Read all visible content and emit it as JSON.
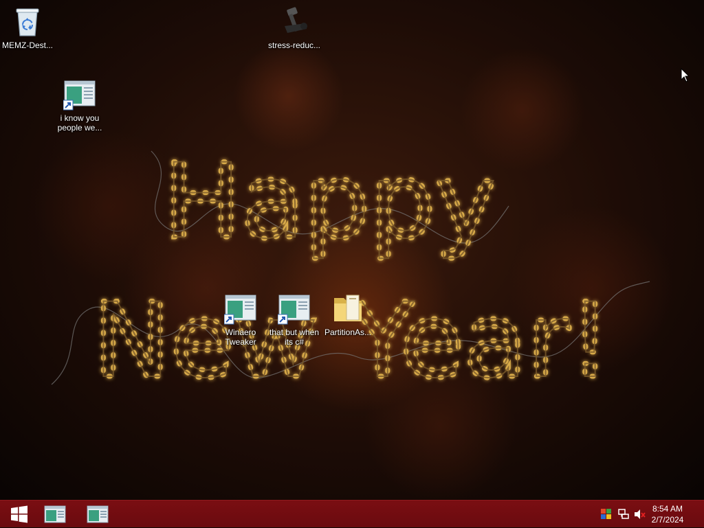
{
  "desktop": {
    "greeting_text": [
      "Happy",
      "New Year!"
    ],
    "icons": [
      {
        "label": "MEMZ-Dest...",
        "icon": "recycle-bin-icon"
      },
      {
        "label": "stress-reduc...",
        "icon": "hammer-tool-icon"
      },
      {
        "label": "i know you people we...",
        "icon": "program-shortcut-icon"
      },
      {
        "label": "Winaero Tweaker",
        "icon": "program-shortcut-icon"
      },
      {
        "label": "that but when its c#",
        "icon": "program-shortcut-icon"
      },
      {
        "label": "PartitionAs...",
        "icon": "folder-icon"
      }
    ]
  },
  "taskbar": {
    "start_icon": "windows-logo-icon",
    "pinned": [
      {
        "name": "taskbar-app-1",
        "icon": "program-window-icon"
      },
      {
        "name": "taskbar-app-2",
        "icon": "program-window-icon"
      }
    ],
    "tray_icons": [
      "action-center-flag-icon",
      "network-icon",
      "volume-muted-icon"
    ],
    "clock": {
      "time": "8:54 AM",
      "date": "2/7/2024"
    },
    "color": "#7a0e12"
  }
}
